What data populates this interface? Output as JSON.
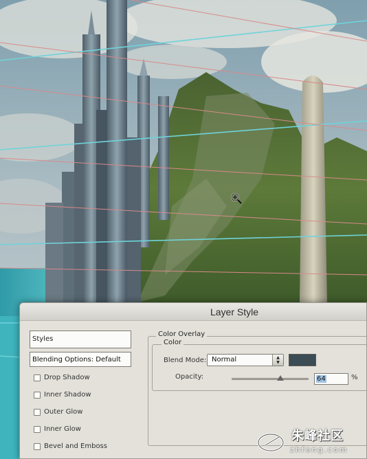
{
  "dialog": {
    "title": "Layer Style"
  },
  "styles_panel": {
    "header": "Styles",
    "blending_options": "Blending Options: Default",
    "effects": [
      {
        "label": "Drop Shadow",
        "checked": false
      },
      {
        "label": "Inner Shadow",
        "checked": false
      },
      {
        "label": "Outer Glow",
        "checked": false
      },
      {
        "label": "Inner Glow",
        "checked": false
      },
      {
        "label": "Bevel and Emboss",
        "checked": false
      }
    ]
  },
  "color_overlay": {
    "group_title": "Color Overlay",
    "subgroup_title": "Color",
    "blend_mode_label": "Blend Mode:",
    "blend_mode_value": "Normal",
    "overlay_color": "#3b4c54",
    "opacity_label": "Opacity:",
    "opacity_value": "64",
    "opacity_fraction": 0.64,
    "opacity_unit": "%"
  },
  "watermark": {
    "site_name": "朱峰社区",
    "url": "zhfeng.com"
  },
  "icons": {
    "cursor": "zoom-crosshair-icon",
    "select_arrows": "up-down-arrows-icon"
  },
  "colors": {
    "dialog_bg": "#e3e1da",
    "guide_cyan": "#6fd3da",
    "guide_red": "#d88a8a",
    "selection_blue": "#9fc3e6"
  }
}
